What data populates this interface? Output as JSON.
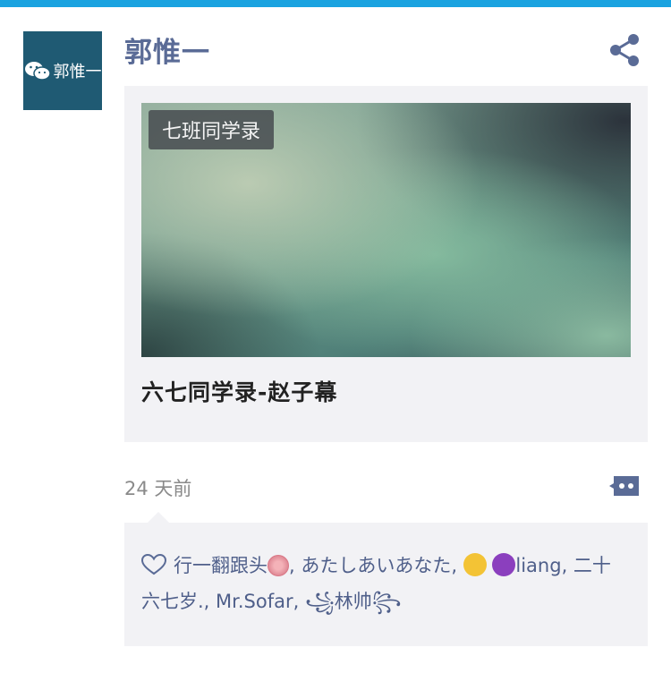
{
  "colors": {
    "accent_bar": "#1aa3e0",
    "name_color": "#5a6b96",
    "card_bg": "#f2f2f5"
  },
  "post": {
    "avatar_text": "郭惟一",
    "author": "郭惟一",
    "share_icon": "share-icon"
  },
  "card": {
    "tag": "七班同学录",
    "title": "六七同学录-赵子幕"
  },
  "meta": {
    "time": "24 天前",
    "comment_icon": "comment-icon"
  },
  "likes": {
    "icon": "heart-icon",
    "names": [
      "行一翻跟头",
      ", あたしあいあなた, ",
      "liang",
      ", 二十六七岁., Mr.Sofar, ",
      "꧁林帅꧂"
    ]
  }
}
